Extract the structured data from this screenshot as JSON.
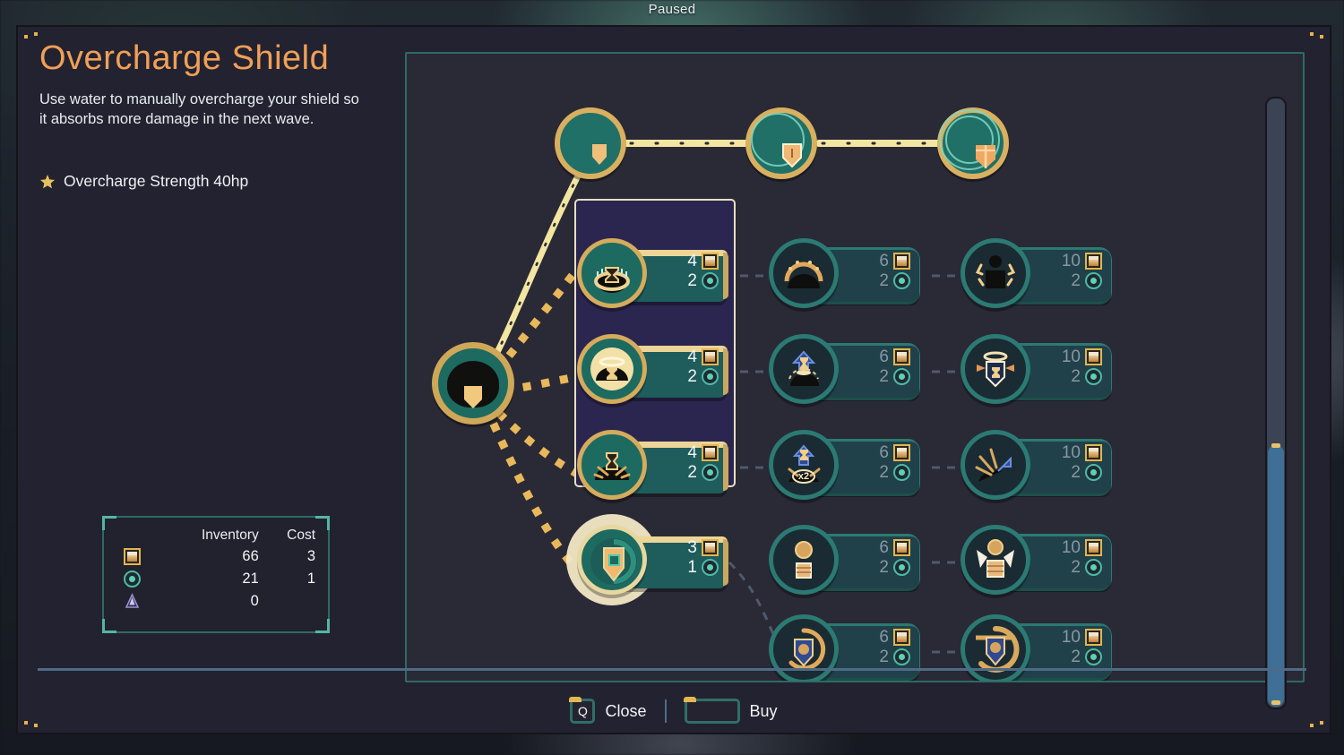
{
  "hud": {
    "paused_label": "Paused"
  },
  "info": {
    "title": "Overcharge Shield",
    "description": "Use water to manually overcharge your shield so it absorbs more damage in the next wave.",
    "stat_icon": "star-icon",
    "stat_label": "Overcharge Strength 40hp"
  },
  "inventory": {
    "header_inventory": "Inventory",
    "header_cost": "Cost",
    "rows": [
      {
        "icon": "sand-resource-icon",
        "quantity": "66",
        "cost": "3"
      },
      {
        "icon": "gear-resource-icon",
        "quantity": "21",
        "cost": "1"
      },
      {
        "icon": "obelisk-resource-icon",
        "quantity": "0",
        "cost": ""
      }
    ]
  },
  "tree": {
    "tiers": [
      {
        "name": "tier-node-1",
        "icon": "shield-plain-icon",
        "rings": 0
      },
      {
        "name": "tier-node-2",
        "icon": "shield-outline-icon",
        "rings": 1
      },
      {
        "name": "tier-node-3",
        "icon": "shield-cube-icon",
        "rings": 2
      }
    ],
    "root": {
      "name": "root-node",
      "icon": "shield-dome-icon"
    },
    "cards": [
      {
        "id": "c1r1",
        "col": 1,
        "row": 1,
        "icon": "hourglass-crown-icon",
        "state": "available",
        "sand": "4",
        "gear": "2"
      },
      {
        "id": "c1r2",
        "col": 1,
        "row": 2,
        "icon": "hourglass-halo-icon",
        "state": "available",
        "sand": "4",
        "gear": "2"
      },
      {
        "id": "c1r3",
        "col": 1,
        "row": 3,
        "icon": "hourglass-burst-icon",
        "state": "available",
        "sand": "4",
        "gear": "2"
      },
      {
        "id": "c1r4",
        "col": 1,
        "row": 4,
        "icon": "overcharge-shield-icon",
        "state": "selected",
        "sand": "3",
        "gear": "1"
      },
      {
        "id": "c2r1",
        "col": 2,
        "row": 1,
        "icon": "dome-flare-icon",
        "state": "locked",
        "sand": "6",
        "gear": "2"
      },
      {
        "id": "c2r2",
        "col": 2,
        "row": 2,
        "icon": "hourglass-up-icon",
        "state": "locked",
        "sand": "6",
        "gear": "2"
      },
      {
        "id": "c2r3",
        "col": 2,
        "row": 3,
        "icon": "hourglass-x2-icon",
        "state": "locked",
        "sand": "6",
        "gear": "2"
      },
      {
        "id": "c2r4",
        "col": 2,
        "row": 4,
        "icon": "coin-fist-icon",
        "state": "locked",
        "sand": "6",
        "gear": "2"
      },
      {
        "id": "c2r5",
        "col": 2,
        "row": 5,
        "icon": "shield-cycle-icon",
        "state": "locked",
        "sand": "6",
        "gear": "2"
      },
      {
        "id": "c3r1",
        "col": 3,
        "row": 1,
        "icon": "figure-power-icon",
        "state": "locked",
        "sand": "10",
        "gear": "2"
      },
      {
        "id": "c3r2",
        "col": 3,
        "row": 2,
        "icon": "shield-halo-icon",
        "state": "locked",
        "sand": "10",
        "gear": "2"
      },
      {
        "id": "c3r3",
        "col": 3,
        "row": 3,
        "icon": "arrow-burst-icon",
        "state": "locked",
        "sand": "10",
        "gear": "2"
      },
      {
        "id": "c3r4",
        "col": 3,
        "row": 4,
        "icon": "fist-coin-burst-icon",
        "state": "locked",
        "sand": "10",
        "gear": "2"
      },
      {
        "id": "c3r5",
        "col": 3,
        "row": 5,
        "icon": "shield-gear-cycle-icon",
        "state": "locked",
        "sand": "10",
        "gear": "2"
      }
    ]
  },
  "footer": {
    "close_key": "Q",
    "close_label": "Close",
    "buy_key": "",
    "buy_label": "Buy"
  },
  "colors": {
    "accent_title": "#f0a057",
    "panel_bg": "#232230",
    "tree_border": "#2d6b63",
    "gold": "#d9b05f",
    "teal": "#1f5c5c",
    "locked": "#20414a",
    "selected_box": "#2b2650"
  }
}
